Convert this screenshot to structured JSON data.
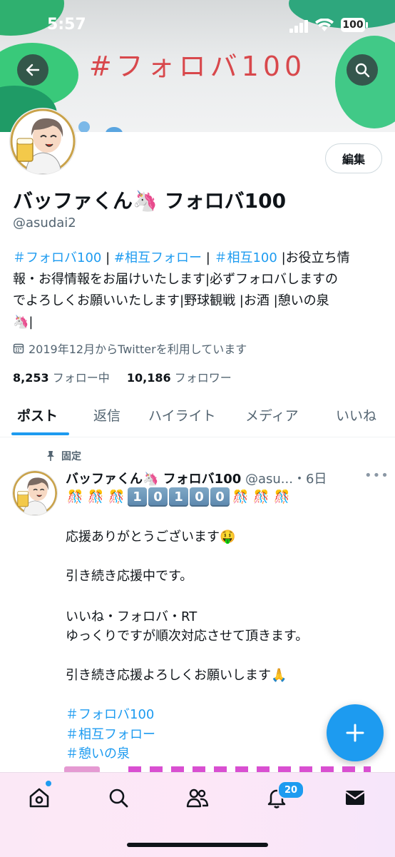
{
  "status_bar": {
    "time": "5:57",
    "battery": "100"
  },
  "banner": {
    "title": "#フォロバ100"
  },
  "profile": {
    "edit_label": "編集",
    "display_name": "バッファくん🦄 フォロバ100",
    "handle": "@asudai2",
    "bio": {
      "line1_tag1": "＃フォロバ100",
      "line1_sep1": " | ",
      "line1_tag2": "#相互フォロー",
      "line1_sep2": " | ",
      "line1_tag3": "＃相互100",
      "line1_rest": " |お役立ち情",
      "line2": "報・お得情報をお届けいたします|必ずフォロバしますの",
      "line3": "でよろしくお願いいたします|野球観戦 |お酒 |憩いの泉",
      "line4": "🦄|"
    },
    "joined": "2019年12月からTwitterを利用しています",
    "following_count": "8,253",
    "following_label": " フォロー中",
    "followers_count": "10,186",
    "followers_label": " フォロワー"
  },
  "tabs": [
    {
      "label": "ポスト",
      "active": true
    },
    {
      "label": "返信"
    },
    {
      "label": "ハイライト"
    },
    {
      "label": "メディア"
    },
    {
      "label": "いいね"
    }
  ],
  "post": {
    "pinned_label": "固定",
    "author": "バッファくん🦄 フォロバ100",
    "meta": " @asu...・6日",
    "keycaps": [
      "1",
      "0",
      "1",
      "0",
      "0"
    ],
    "lines": [
      "応援ありがとうございます🤑",
      "引き続き応援中です。",
      "いいね・フォロバ・RT",
      "ゆっくりですが順次対応させて頂きます。",
      "引き続き応援よろしくお願いします🙏"
    ],
    "tags": [
      "＃フォロバ100",
      "＃相互フォロー",
      "＃憩いの泉"
    ]
  },
  "bottom_nav": {
    "notification_count": "20"
  },
  "colors": {
    "accent": "#1d9bf0",
    "banner_text": "#d8484c",
    "nav_bg": "#fbe8f6"
  }
}
